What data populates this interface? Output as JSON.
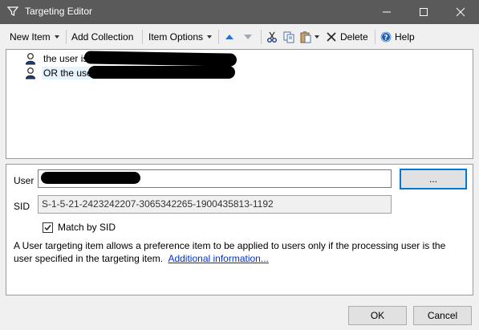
{
  "window": {
    "title": "Targeting Editor",
    "icon": "filter-icon"
  },
  "toolbar": {
    "new_item": "New Item",
    "add_collection": "Add Collection",
    "item_options": "Item Options",
    "delete": "Delete",
    "help": "Help"
  },
  "tree": {
    "items": [
      {
        "label": "the user is",
        "icon": "user-icon"
      },
      {
        "label": "OR the user",
        "icon": "user-icon"
      }
    ]
  },
  "props": {
    "user_label": "User",
    "user_value": "",
    "browse_label": "...",
    "sid_label": "SID",
    "sid_value": "S-1-5-21-2423242207-3065342265-1900435813-1192",
    "match_label": "Match by SID",
    "match_checked": true,
    "description": "A User targeting item allows a preference item to be applied to users only if the processing user is the user specified in the targeting item.",
    "link": "Additional information..."
  },
  "footer": {
    "ok": "OK",
    "cancel": "Cancel"
  },
  "colors": {
    "titlebar": "#5a5a5a",
    "accent": "#0078d7",
    "link": "#0033cc"
  }
}
